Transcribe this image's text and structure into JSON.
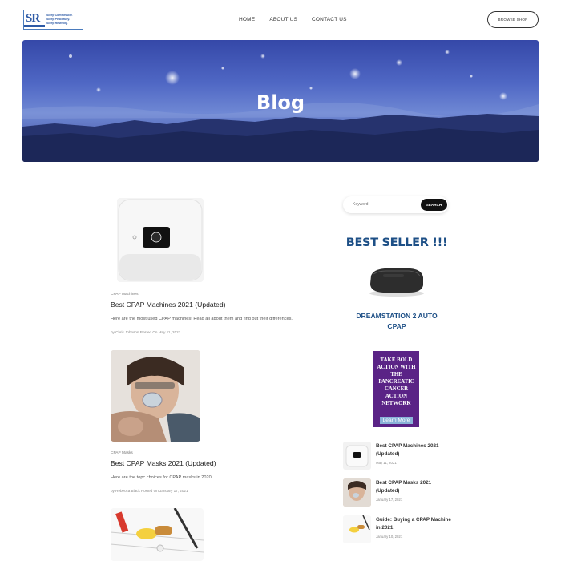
{
  "header": {
    "logo_letters": "SR",
    "logo_tagline": [
      "Sleep Comfortably.",
      "Sleep Peacefully.",
      "Sleep Restfully."
    ],
    "nav": [
      "HOME",
      "ABOUT US",
      "CONTACT US"
    ],
    "browse_label": "BROWSE SHOP"
  },
  "hero": {
    "title": "Blog"
  },
  "posts": [
    {
      "category": "CPAP Machines",
      "title": "Best CPAP Machines 2021 (Updated)",
      "excerpt": "Here are the most used CPAP machines! Read all about them and find out their differences.",
      "meta": "by Chris Johnson Posted On May 11, 2021"
    },
    {
      "category": "CPAP Masks",
      "title": "Best CPAP Masks 2021 (Updated)",
      "excerpt": "Here are the topc choices for CPAP masks in 2020.",
      "meta": "by Rebecca Black Posted On January 17, 2021"
    }
  ],
  "sidebar": {
    "search_placeholder": "Keyword",
    "search_button": "SEARCH",
    "bestseller": "BEST SELLER !!!",
    "product": "DREAMSTATION 2 AUTO CPAP",
    "ad": {
      "text": "TAKE BOLD ACTION WITH THE PANCREATIC CANCER ACTION NETWORK",
      "button": "Learn More"
    },
    "recent": [
      {
        "title": "Best CPAP Machines 2021 (Updated)",
        "date": "May 11, 2021"
      },
      {
        "title": "Best CPAP Masks 2021 (Updated)",
        "date": "January 17, 2021"
      },
      {
        "title": "Guide: Buying a CPAP Machine in 2021",
        "date": "January 10, 2021"
      }
    ]
  },
  "colors": {
    "brand_blue": "#1d4f86",
    "ad_purple": "#5a2386",
    "hero_blue": "#4f67c4"
  }
}
